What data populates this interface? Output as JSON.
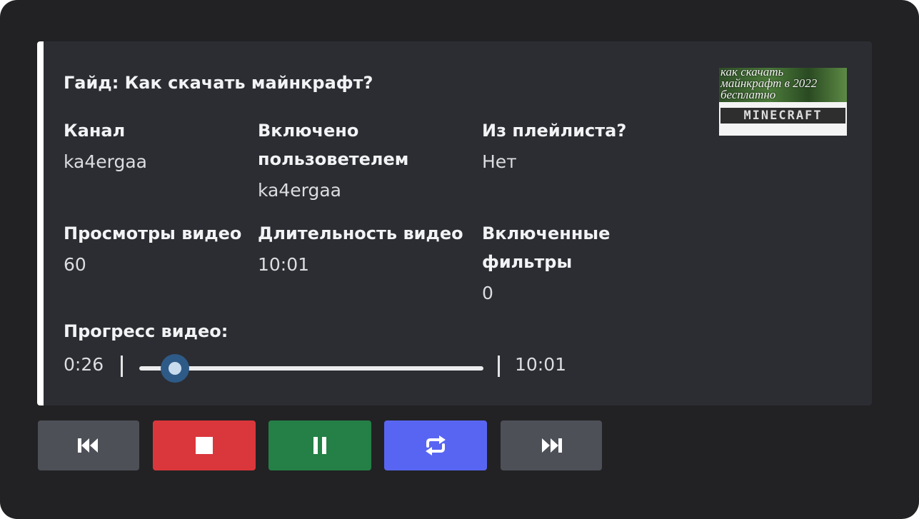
{
  "embed": {
    "title": "Гайд: Как скачать майнкрафт?",
    "thumbnail_caption": "как скачать майнкрафт в 2022 бесплатно",
    "thumbnail_logo": "MINECRAFT",
    "fields": {
      "channel": {
        "name": "Канал",
        "value": "ka4ergaa"
      },
      "requested_by": {
        "name": "Включено пользоветелем",
        "value": "ka4ergaa"
      },
      "from_playlist": {
        "name": "Из плейлиста?",
        "value": "Нет"
      },
      "views": {
        "name": "Просмотры видео",
        "value": "60"
      },
      "duration": {
        "name": "Длительность видео",
        "value": "10:01"
      },
      "filters": {
        "name": "Включенные фильтры",
        "value": "0"
      }
    },
    "progress": {
      "label": "Прогресс видео:",
      "current": "0:26",
      "total": "10:01",
      "fraction": 0.043
    }
  },
  "buttons": [
    {
      "name": "previous",
      "icon": "skip-previous-icon",
      "color": "#4e5058"
    },
    {
      "name": "stop",
      "icon": "stop-icon",
      "color": "#da373c"
    },
    {
      "name": "pause",
      "icon": "pause-icon",
      "color": "#248046"
    },
    {
      "name": "loop",
      "icon": "repeat-icon",
      "color": "#5865f2"
    },
    {
      "name": "next",
      "icon": "skip-next-icon",
      "color": "#4e5058"
    }
  ],
  "colors": {
    "background": "#222224",
    "embed_background": "#2c2d32",
    "embed_accent": "#ffffff",
    "slider_knob": "#2e5a87"
  }
}
